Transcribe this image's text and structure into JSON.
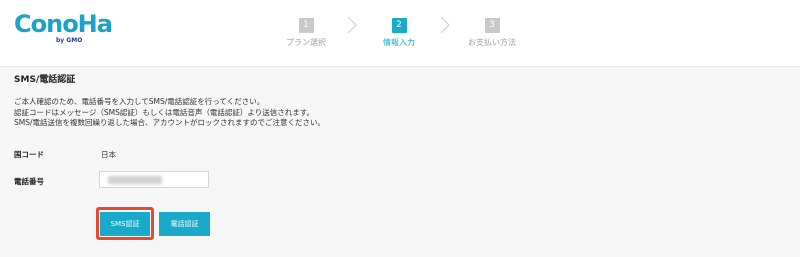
{
  "brand": {
    "logo_text": "ConoHa",
    "logo_sub": "by GMO",
    "color": "#19a3c9"
  },
  "steps": [
    {
      "number": "1",
      "label": "プラン選択",
      "active": false
    },
    {
      "number": "2",
      "label": "情報入力",
      "active": true
    },
    {
      "number": "3",
      "label": "お支払い方法",
      "active": false
    }
  ],
  "section": {
    "title": "SMS/電話認証",
    "description": [
      "ご本人確認のため、電話番号を入力してSMS/電話認証を行ってください。",
      "認証コードはメッセージ（SMS認証）もしくは電話音声（電話認証）より送信されます。",
      "SMS/電話送信を複数回繰り返した場合、アカウントがロックされますのでご注意ください。"
    ]
  },
  "form": {
    "country_label": "国コード",
    "country_value": "日本",
    "phone_label": "電話番号",
    "phone_value": ""
  },
  "buttons": {
    "sms": "SMS認証",
    "phone": "電話認証"
  },
  "colors": {
    "accent": "#19a9c9",
    "inactive_step": "#c8c8c8",
    "highlight": "#e34a2e"
  }
}
